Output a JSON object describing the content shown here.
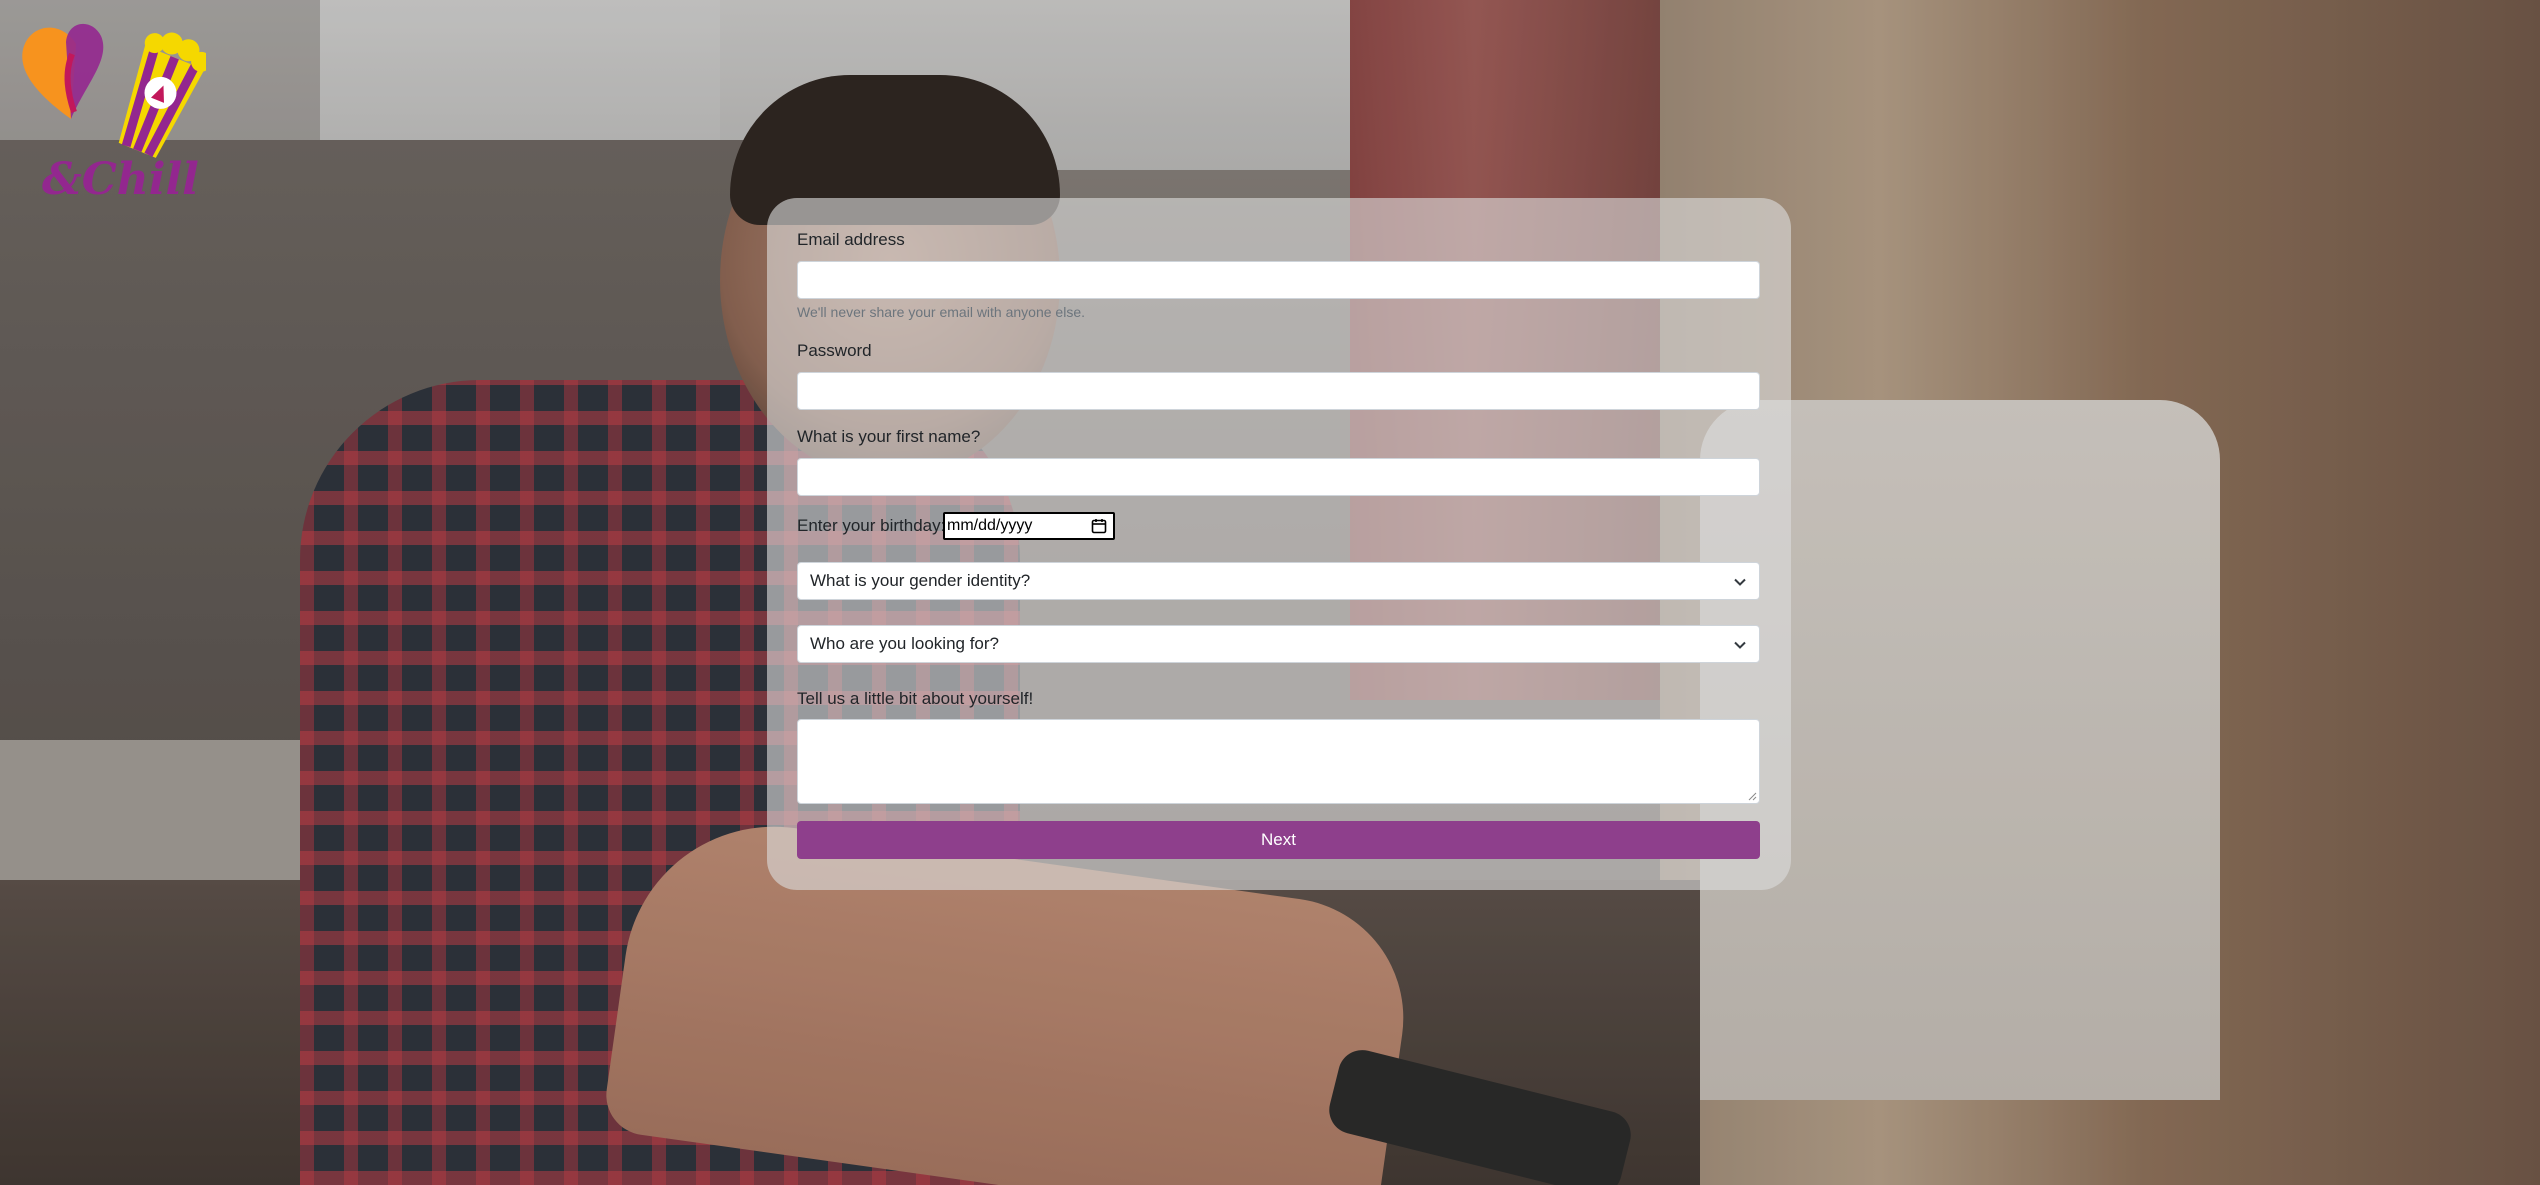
{
  "logo": {
    "text": "&Chill",
    "colors": {
      "orange": "#f7931e",
      "purple": "#93278f",
      "yellow": "#f5d800",
      "pink": "#c2185b"
    }
  },
  "form": {
    "email_label": "Email address",
    "email_value": "",
    "email_help": "We'll never share your email with anyone else.",
    "password_label": "Password",
    "password_value": "",
    "first_name_label": "What is your first name?",
    "first_name_value": "",
    "birthday_label": "Enter your birthday:",
    "birthday_placeholder": "mm/dd/yyyy",
    "gender_select": "What is your gender identity?",
    "looking_for_select": "Who are you looking for?",
    "about_label": "Tell us a little bit about yourself!",
    "about_value": "",
    "next_label": "Next"
  },
  "colors": {
    "button": "#8e3f8c",
    "panel": "rgba(220,220,220,0.62)"
  }
}
